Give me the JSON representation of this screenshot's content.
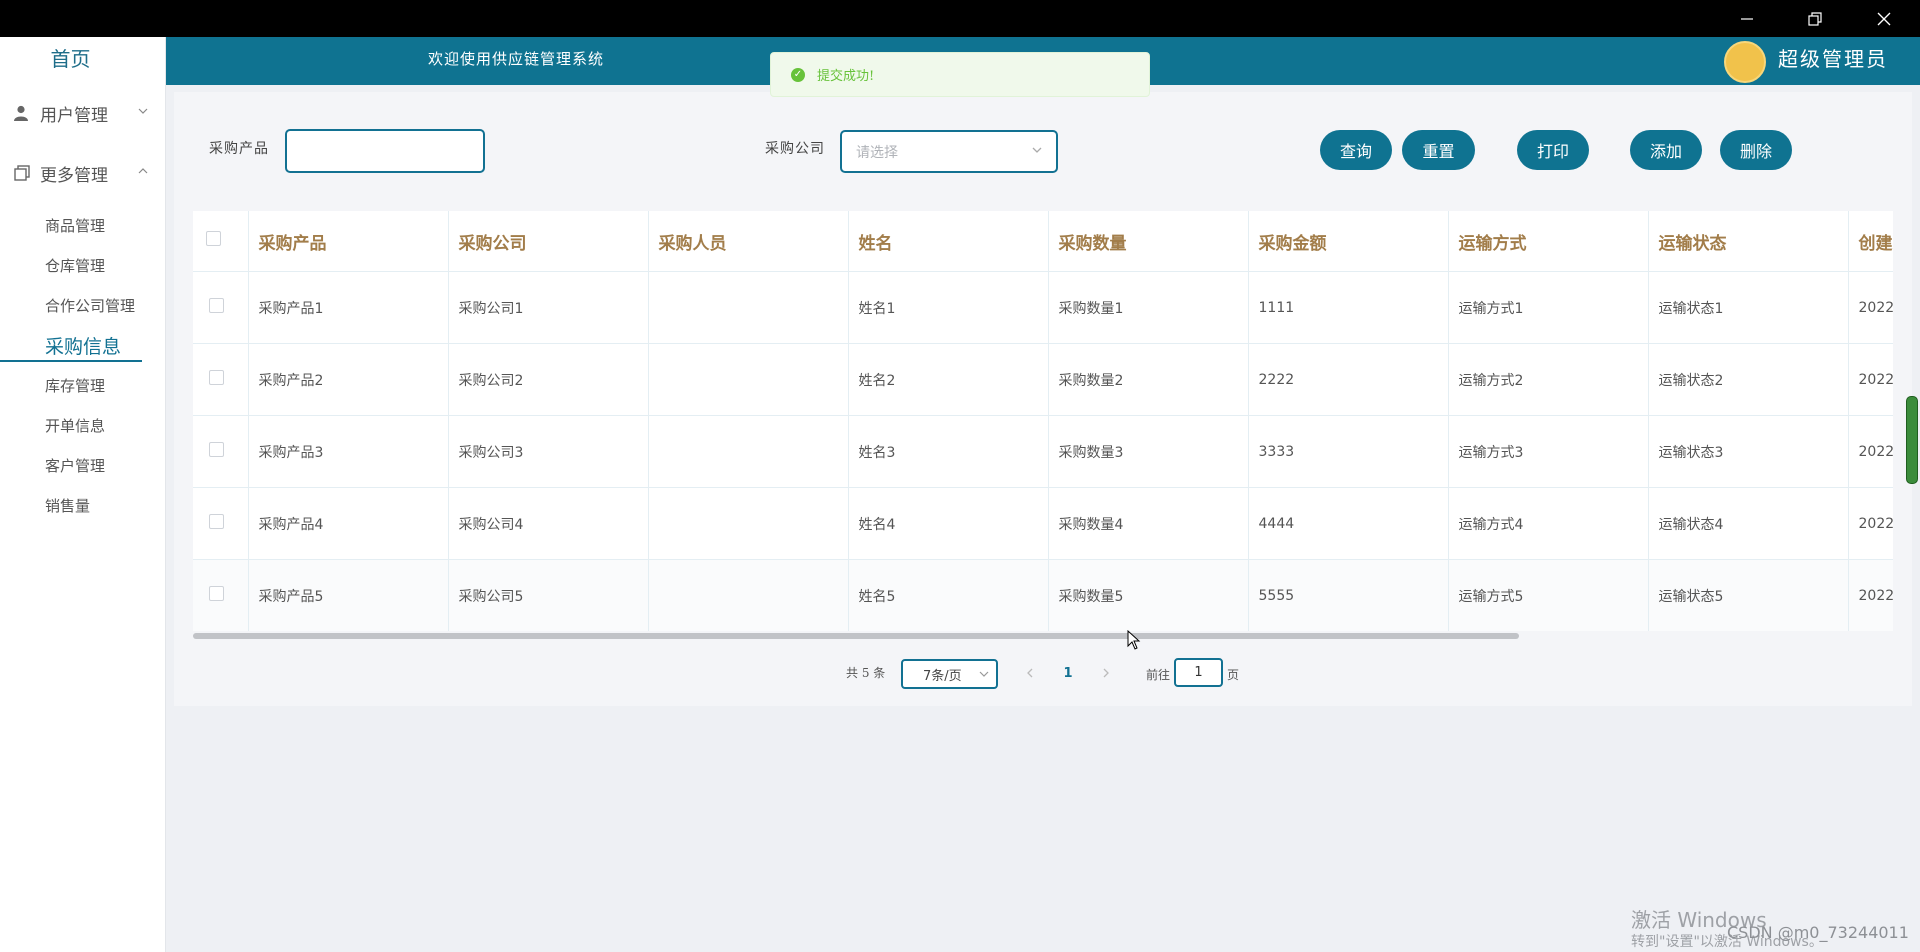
{
  "sidebar": {
    "home": "首页",
    "menus": [
      {
        "label": "用户管理",
        "icon": "user-icon",
        "expanded": false
      },
      {
        "label": "更多管理",
        "icon": "copy-icon",
        "expanded": true
      }
    ],
    "items": [
      {
        "label": "商品管理",
        "active": false
      },
      {
        "label": "仓库管理",
        "active": false
      },
      {
        "label": "合作公司管理",
        "active": false
      },
      {
        "label": "采购信息",
        "active": true
      },
      {
        "label": "库存管理",
        "active": false
      },
      {
        "label": "开单信息",
        "active": false
      },
      {
        "label": "客户管理",
        "active": false
      },
      {
        "label": "销售量",
        "active": false
      }
    ]
  },
  "header": {
    "welcome": "欢迎使用供应链管理系统",
    "user": "超级管理员"
  },
  "toast": {
    "message": "提交成功!"
  },
  "search": {
    "product_label": "采购产品",
    "product_value": "",
    "company_label": "采购公司",
    "company_placeholder": "请选择"
  },
  "buttons": {
    "query": "查询",
    "reset": "重置",
    "print": "打印",
    "add": "添加",
    "delete": "删除"
  },
  "table": {
    "columns": [
      "采购产品",
      "采购公司",
      "采购人员",
      "姓名",
      "采购数量",
      "采购金额",
      "运输方式",
      "运输状态",
      "创建"
    ],
    "rows": [
      [
        "采购产品1",
        "采购公司1",
        "",
        "姓名1",
        "采购数量1",
        "1111",
        "运输方式1",
        "运输状态1",
        "2022"
      ],
      [
        "采购产品2",
        "采购公司2",
        "",
        "姓名2",
        "采购数量2",
        "2222",
        "运输方式2",
        "运输状态2",
        "2022"
      ],
      [
        "采购产品3",
        "采购公司3",
        "",
        "姓名3",
        "采购数量3",
        "3333",
        "运输方式3",
        "运输状态3",
        "2022"
      ],
      [
        "采购产品4",
        "采购公司4",
        "",
        "姓名4",
        "采购数量4",
        "4444",
        "运输方式4",
        "运输状态4",
        "2022"
      ],
      [
        "采购产品5",
        "采购公司5",
        "",
        "姓名5",
        "采购数量5",
        "5555",
        "运输方式5",
        "运输状态5",
        "2022"
      ]
    ]
  },
  "pagination": {
    "total": "共 5 条",
    "page_size": "7条/页",
    "current_page": "1",
    "goto_label": "前往",
    "goto_value": "1",
    "page_suffix": "页"
  },
  "watermark": {
    "activate_title": "激活 Windows",
    "activate_sub": "转到\"设置\"以激活 Windows。",
    "csdn": "CSDN @m0_73244011"
  },
  "colors": {
    "primary": "#0f7391",
    "header_text": "#a27d4a",
    "success": "#67c23a"
  }
}
